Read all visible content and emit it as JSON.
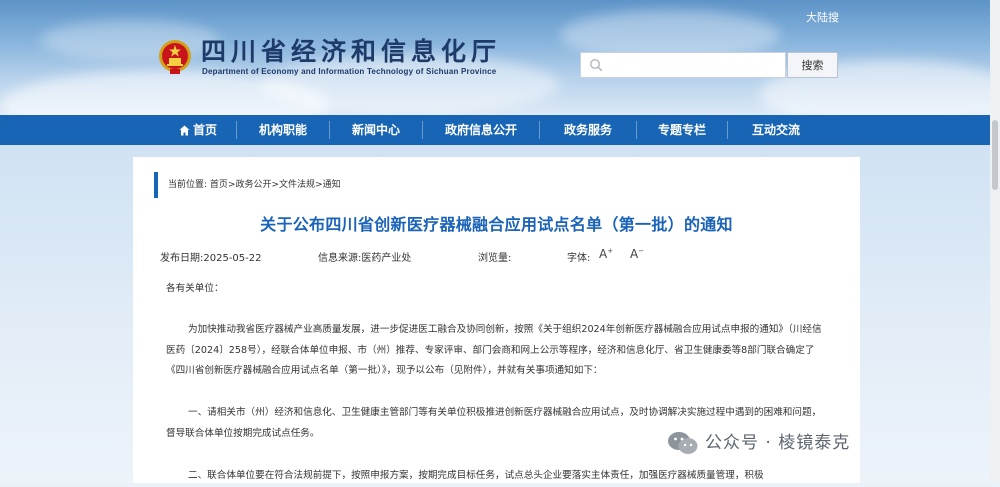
{
  "header": {
    "top_link": "大陆搜",
    "title": "四川省经济和信息化厅",
    "subtitle": "Department of Economy and Information Technology of Sichuan Province",
    "search": {
      "placeholder": "",
      "button_label": "搜索"
    }
  },
  "nav": {
    "items": [
      {
        "label": "首页",
        "icon": "home-icon"
      },
      {
        "label": "机构职能"
      },
      {
        "label": "新闻中心"
      },
      {
        "label": "政府信息公开"
      },
      {
        "label": "政务服务"
      },
      {
        "label": "专题专栏"
      },
      {
        "label": "互动交流"
      }
    ]
  },
  "breadcrumb": {
    "prefix": "当前位置:",
    "items": [
      "首页",
      "政务公开",
      "文件法规",
      "通知"
    ],
    "separator": ">"
  },
  "article": {
    "title": "关于公布四川省创新医疗器械融合应用试点名单（第一批）的通知",
    "meta": {
      "date_label": "发布日期:",
      "date": "2025-05-22",
      "source_label": "信息来源:",
      "source": "医药产业处",
      "views_label": "浏览量:",
      "font_label": "字体:",
      "font_increase": "A",
      "font_decrease": "A"
    },
    "paragraphs": [
      "各有关单位：",
      "为加快推动我省医疗器械产业高质量发展，进一步促进医工融合及协同创新，按照《关于组织2024年创新医疗器械融合应用试点申报的通知》（川经信医药〔2024〕258号），经联合体单位申报、市（州）推荐、专家评审、部门会商和网上公示等程序，经济和信息化厅、省卫生健康委等8部门联合确定了《四川省创新医疗器械融合应用试点名单（第一批）》，现予以公布（见附件），并就有关事项通知如下：",
      "一、请相关市（州）经济和信息化、卫生健康主管部门等有关单位积极推进创新医疗器械融合应用试点，及时协调解决实施过程中遇到的困难和问题，督导联合体单位按期完成试点任务。",
      "二、联合体单位要在符合法规前提下，按照申报方案，按期完成目标任务，试点总头企业要落实主体责任，加强医疗器械质量管理，积极"
    ]
  },
  "watermark": {
    "text": "公众号 · 棱镜泰克"
  },
  "colors": {
    "nav": "#1765b4",
    "title": "#1a63b8",
    "brand": "#1e3a68"
  }
}
